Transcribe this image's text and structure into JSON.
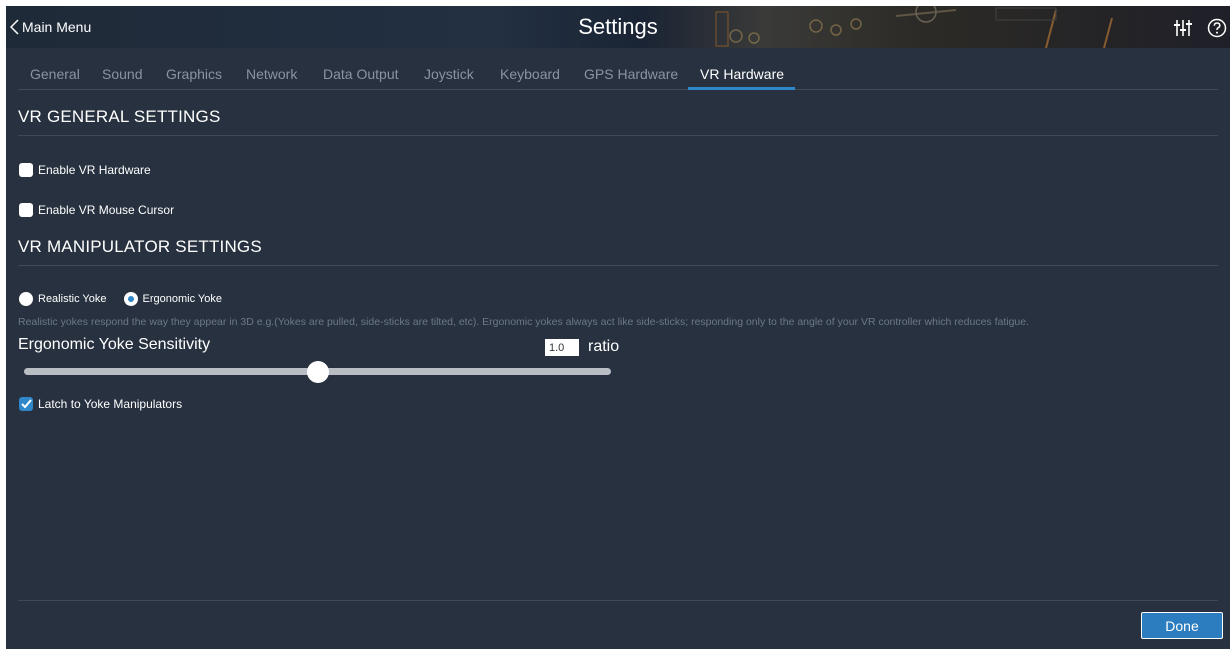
{
  "header": {
    "back_label": "Main Menu",
    "title": "Settings",
    "icons": [
      "back-chevron-icon",
      "sliders-icon",
      "help-icon"
    ]
  },
  "tabs": [
    {
      "label": "General",
      "active": false
    },
    {
      "label": "Sound",
      "active": false
    },
    {
      "label": "Graphics",
      "active": false
    },
    {
      "label": "Network",
      "active": false
    },
    {
      "label": "Data Output",
      "active": false
    },
    {
      "label": "Joystick",
      "active": false
    },
    {
      "label": "Keyboard",
      "active": false
    },
    {
      "label": "GPS Hardware",
      "active": false
    },
    {
      "label": "VR Hardware",
      "active": true
    }
  ],
  "vr_general": {
    "heading": "VR GENERAL SETTINGS",
    "enable_vr_hardware": {
      "label": "Enable VR Hardware",
      "checked": false
    },
    "enable_vr_mouse_cursor": {
      "label": "Enable VR Mouse Cursor",
      "checked": false
    }
  },
  "vr_manipulator": {
    "heading": "VR MANIPULATOR SETTINGS",
    "yoke_mode": {
      "options": [
        {
          "label": "Realistic Yoke",
          "selected": false
        },
        {
          "label": "Ergonomic Yoke",
          "selected": true
        }
      ]
    },
    "description": "Realistic yokes respond the way they appear in 3D e.g.(Yokes are pulled, side-sticks are tilted, etc). Ergonomic yokes always act like side-sticks; responding only to the angle of your VR controller which reduces fatigue.",
    "sensitivity": {
      "label": "Ergonomic Yoke Sensitivity",
      "value": "1.0",
      "unit": "ratio",
      "slider_fraction": 0.5
    },
    "latch": {
      "label": "Latch to Yoke Manipulators",
      "checked": true
    }
  },
  "footer": {
    "done_label": "Done"
  },
  "colors": {
    "accent": "#2f86c8",
    "background": "#27313f",
    "muted_text": "#8a94a1"
  }
}
